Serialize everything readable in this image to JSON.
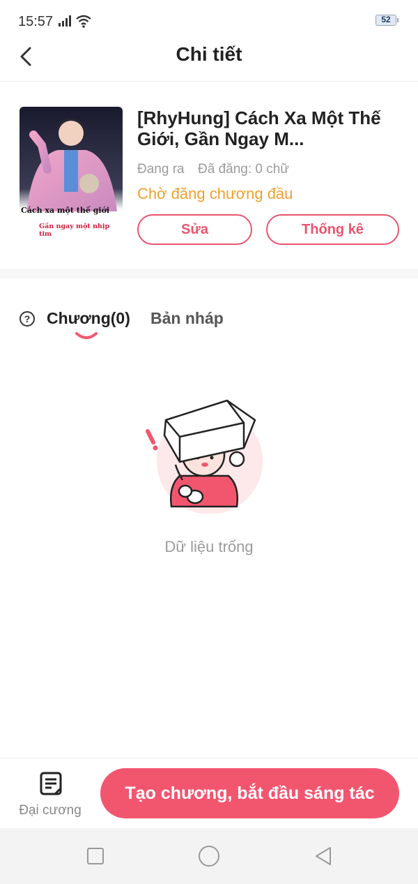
{
  "status_bar": {
    "time": "15:57",
    "battery": "52"
  },
  "header": {
    "title": "Chi tiết"
  },
  "story": {
    "cover": {
      "line1": "Cách xa một thế giới",
      "line2": "Gần ngay một nhịp tim"
    },
    "title": "[RhyHung] Cách Xa Một Thế Giới, Gần Ngay M...",
    "status": "Đang ra",
    "published": "Đã đăng: 0 chữ",
    "waiting": "Chờ đăng chương đầu",
    "edit_label": "Sửa",
    "stats_label": "Thống kê"
  },
  "tabs": {
    "chapters": "Chương(0)",
    "drafts": "Bản nháp"
  },
  "empty": {
    "text": "Dữ liệu trống"
  },
  "bottom": {
    "outline_label": "Đại cương",
    "create_label": "Tạo chương, bắt đầu sáng tác"
  },
  "colors": {
    "accent": "#f2566f",
    "waiting": "#f0a02c",
    "muted": "#9b9b9b"
  }
}
